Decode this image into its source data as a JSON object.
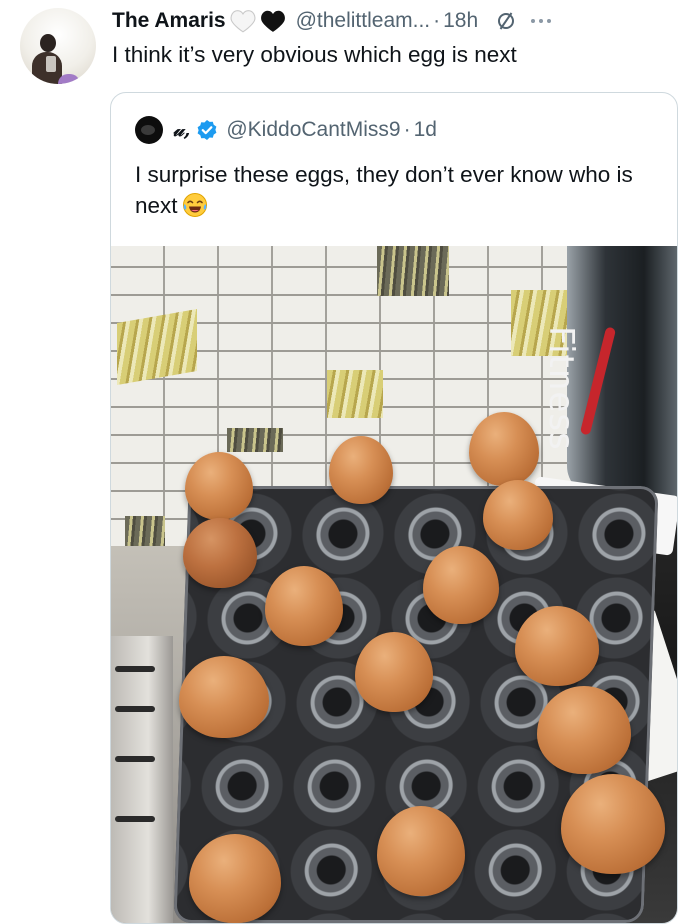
{
  "tweet": {
    "author_name": "The Amaris",
    "handle": "@thelittleam...",
    "separator": "·",
    "time": "18h",
    "text": "I think it’s very obvious which egg is next",
    "header_icons": [
      "white-heart-icon",
      "black-heart-icon",
      "slashed-circle-icon",
      "more-icon"
    ]
  },
  "quote": {
    "author_name": "𝓊,",
    "verified": true,
    "handle": "@KiddoCantMiss9",
    "separator": "·",
    "time": "1d",
    "text": "I surprise these eggs, they don’t ever know who is next",
    "emoji": "face-with-tears-of-joy-icon"
  },
  "photo": {
    "visible_text": "Fitness"
  },
  "colors": {
    "text_primary": "#0f1419",
    "text_secondary": "#536471",
    "verified_blue": "#1d9bf0",
    "border": "#cfd9de"
  }
}
